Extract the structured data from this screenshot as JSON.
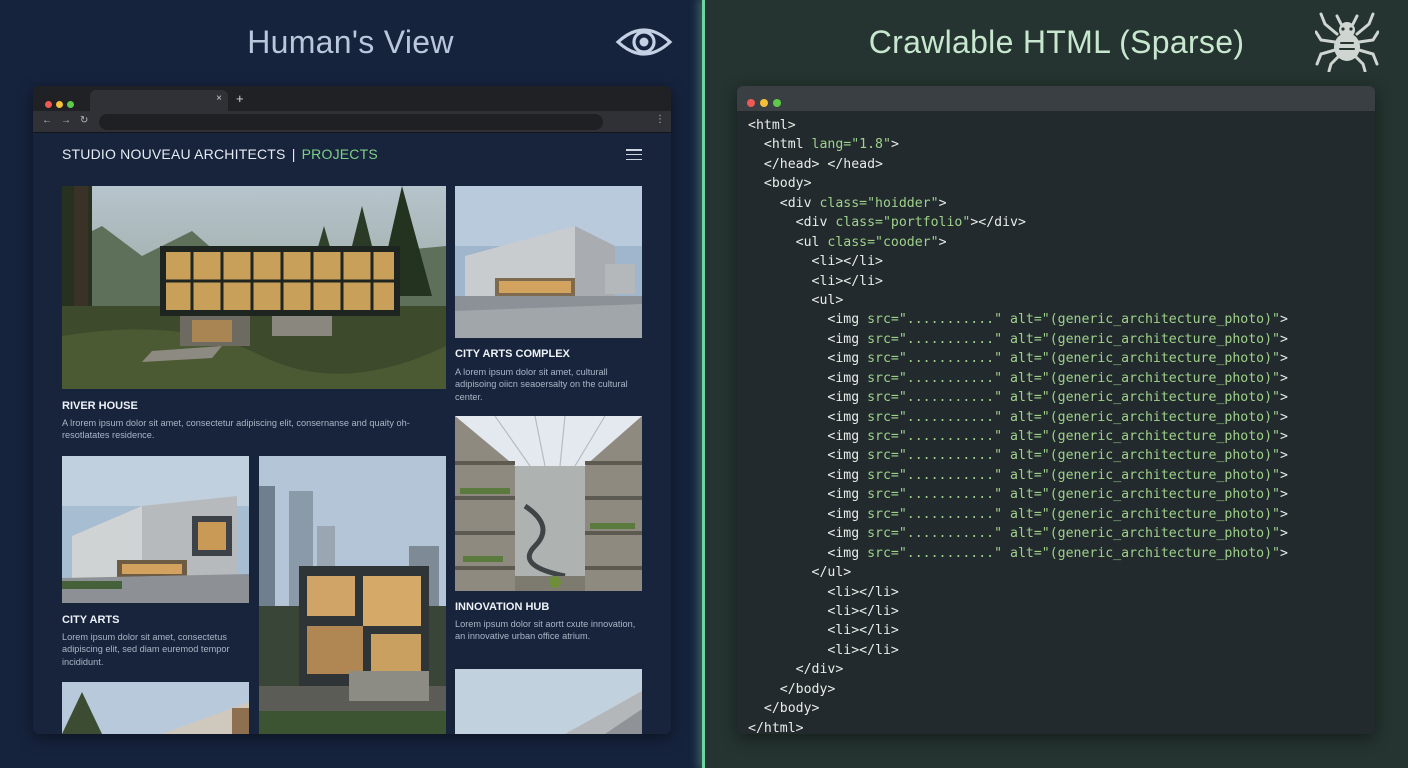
{
  "left_panel": {
    "title": "Human's View",
    "icon": "eye-icon"
  },
  "right_panel": {
    "title": "Crawlable HTML (Sparse)",
    "icon": "spider-icon"
  },
  "browser": {
    "tab_close": "×",
    "new_tab": "+",
    "nav": {
      "back": "←",
      "forward": "→",
      "reload": "↻",
      "menu": "⋮"
    },
    "site": {
      "brand": "STUDIO NOUVEAU ARCHITECTS",
      "separator": "|",
      "section": "PROJECTS",
      "menu_icon": "hamburger-icon"
    },
    "projects": [
      {
        "title": "RIVER HOUSE",
        "desc": "A lrorem ipsum dolor sit amet, consectetur adipiscing elit, consernanse and quaity oh-resotlatates residence."
      },
      {
        "title": "CITY ARTS COMPLEX",
        "desc": "A lorem ipsum dolor sit amet, culturall adipisoing oiicn seaoersalty on the cultural center."
      },
      {
        "title": "CITY ARTS",
        "desc": "Lorem ipsum dolor sit amet, consectetus adipiscing elit, sed diam euremod tempor incididunt."
      },
      {
        "title": "INNOVATION HUB",
        "desc": "Lorem ipsum dolor sit aortt cxute innovation, an innovative urban office atrium."
      }
    ]
  },
  "code_lines": [
    [
      [
        "t",
        "<html>"
      ]
    ],
    [
      [
        "t",
        "  <html "
      ],
      [
        "a",
        "lang=\"1.8\""
      ],
      [
        "t",
        ">"
      ]
    ],
    [
      [
        "t",
        "  </head> </head>"
      ]
    ],
    [
      [
        "t",
        "  <body>"
      ]
    ],
    [
      [
        "t",
        "    <div "
      ],
      [
        "a",
        "class=\"hoidder\""
      ],
      [
        "t",
        ">"
      ]
    ],
    [
      [
        "t",
        "      <div "
      ],
      [
        "a",
        "class=\"portfolio\""
      ],
      [
        "t",
        "></div>"
      ]
    ],
    [
      [
        "t",
        "      <ul "
      ],
      [
        "a",
        "class=\"cooder\""
      ],
      [
        "t",
        ">"
      ]
    ],
    [
      [
        "t",
        "        <li></li>"
      ]
    ],
    [
      [
        "t",
        "        <li></li>"
      ]
    ],
    [
      [
        "t",
        "        <ul>"
      ]
    ],
    [
      [
        "t",
        "          <img "
      ],
      [
        "a",
        "src=\"...........\" alt=\"(generic_architecture_photo)\""
      ],
      [
        "t",
        ">"
      ]
    ],
    [
      [
        "t",
        "          <img "
      ],
      [
        "a",
        "src=\"...........\" alt=\"(generic_architecture_photo)\""
      ],
      [
        "t",
        ">"
      ]
    ],
    [
      [
        "t",
        "          <img "
      ],
      [
        "a",
        "src=\"...........\" alt=\"(generic_architecture_photo)\""
      ],
      [
        "t",
        ">"
      ]
    ],
    [
      [
        "t",
        "          <img "
      ],
      [
        "a",
        "src=\"...........\" alt=\"(generic_architecture_photo)\""
      ],
      [
        "t",
        ">"
      ]
    ],
    [
      [
        "t",
        "          <img "
      ],
      [
        "a",
        "src=\"...........\" alt=\"(generic_architecture_photo)\""
      ],
      [
        "t",
        ">"
      ]
    ],
    [
      [
        "t",
        "          <img "
      ],
      [
        "a",
        "src=\"...........\" alt=\"(generic_architecture_photo)\""
      ],
      [
        "t",
        ">"
      ]
    ],
    [
      [
        "t",
        "          <img "
      ],
      [
        "a",
        "src=\"...........\" alt=\"(generic_architecture_photo)\""
      ],
      [
        "t",
        ">"
      ]
    ],
    [
      [
        "t",
        "          <img "
      ],
      [
        "a",
        "src=\"...........\" alt=\"(generic_architecture_photo)\""
      ],
      [
        "t",
        ">"
      ]
    ],
    [
      [
        "t",
        "          <img "
      ],
      [
        "a",
        "src=\"...........\" alt=\"(generic_architecture_photo)\""
      ],
      [
        "t",
        ">"
      ]
    ],
    [
      [
        "t",
        "          <img "
      ],
      [
        "a",
        "src=\"...........\" alt=\"(generic_architecture_photo)\""
      ],
      [
        "t",
        ">"
      ]
    ],
    [
      [
        "t",
        "          <img "
      ],
      [
        "a",
        "src=\"...........\" alt=\"(generic_architecture_photo)\""
      ],
      [
        "t",
        ">"
      ]
    ],
    [
      [
        "t",
        "          <img "
      ],
      [
        "a",
        "src=\"...........\" alt=\"(generic_architecture_photo)\""
      ],
      [
        "t",
        ">"
      ]
    ],
    [
      [
        "t",
        "          <img "
      ],
      [
        "a",
        "src=\"...........\" alt=\"(generic_architecture_photo)\""
      ],
      [
        "t",
        ">"
      ]
    ],
    [
      [
        "t",
        "        </ul>"
      ]
    ],
    [
      [
        "t",
        "          <li></li>"
      ]
    ],
    [
      [
        "t",
        "          <li></li>"
      ]
    ],
    [
      [
        "t",
        "          <li></li>"
      ]
    ],
    [
      [
        "t",
        "          <li></li>"
      ]
    ],
    [
      [
        "t",
        "      </div>"
      ]
    ],
    [
      [
        "t",
        "    </body>"
      ]
    ],
    [
      [
        "t",
        "  </body>"
      ]
    ],
    [
      [
        "t",
        "</html>"
      ]
    ]
  ],
  "colors": {
    "left_bg": "#16233d",
    "right_bg": "#253430",
    "divider_glow": "#6fd3a0",
    "accent_green": "#7fcf86",
    "code_attr": "#9fd18b"
  }
}
